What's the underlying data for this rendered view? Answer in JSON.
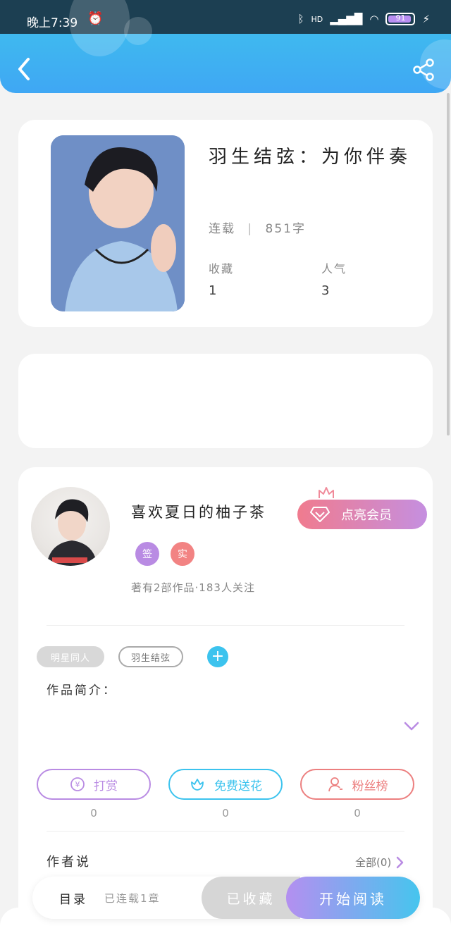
{
  "status_bar": {
    "time": "晚上7:39",
    "network": "HD",
    "battery": "91"
  },
  "book": {
    "title": "羽生结弦：为你伴奏",
    "status": "连载",
    "word_count": "851字",
    "favorites_label": "收藏",
    "favorites_value": "1",
    "popularity_label": "人气",
    "popularity_value": "3"
  },
  "author": {
    "name": "喜欢夏日的柚子茶",
    "badges": [
      {
        "text": "签",
        "color": "#b98be3"
      },
      {
        "text": "实",
        "color": "#f28383"
      }
    ],
    "stats": "著有2部作品·183人关注",
    "vip_label": "点亮会员"
  },
  "tags": [
    "明星同人",
    "羽生结弦"
  ],
  "intro_label": "作品简介：",
  "actions": [
    {
      "label": "打赏",
      "count": "0",
      "color": "#b98be3"
    },
    {
      "label": "免费送花",
      "count": "0",
      "color": "#3cc3ee"
    },
    {
      "label": "粉丝榜",
      "count": "0",
      "color": "#ec7f7f"
    }
  ],
  "author_says": {
    "label": "作者说",
    "all_link": "全部(0)"
  },
  "bottom_bar": {
    "toc_label": "目录",
    "toc_status": "已连载1章",
    "collected_label": "已收藏",
    "read_label": "开始阅读"
  },
  "colors": {
    "header": "#3fb0f2",
    "accent_purple": "#b48ff0",
    "accent_blue": "#46c5ee",
    "vip_pink": "#f07b8e"
  }
}
